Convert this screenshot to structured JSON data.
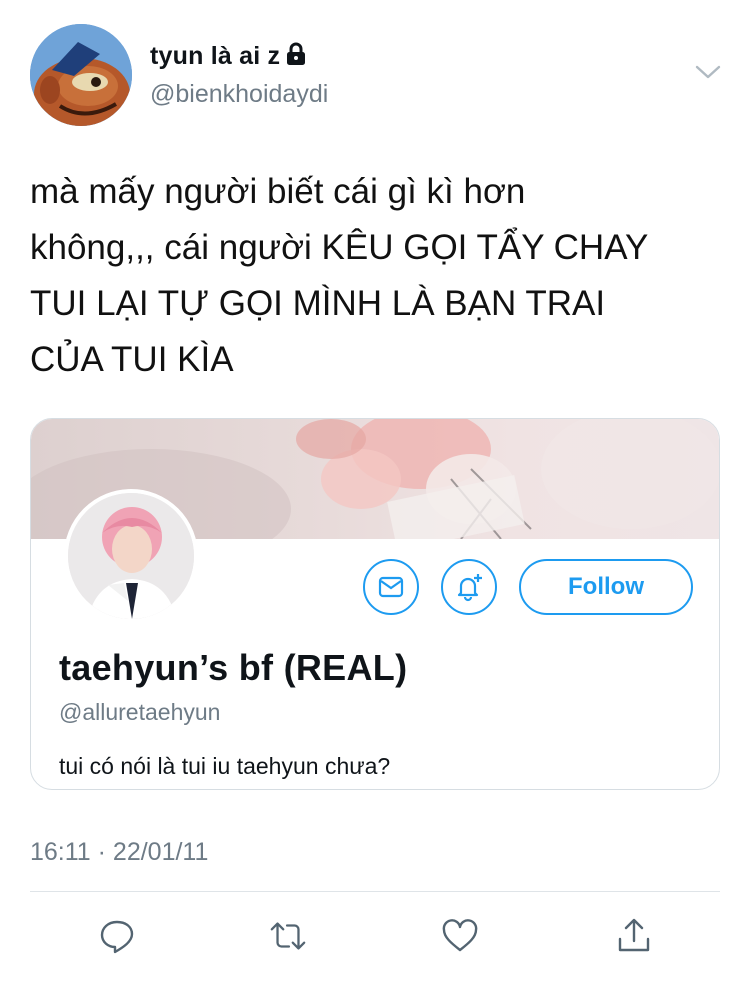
{
  "author": {
    "display_name": "tyun là ai z",
    "handle": "@bienkhoidaydi",
    "protected_icon": "lock-icon",
    "avatar_icon": "cartoon-fish-avatar"
  },
  "tweet": {
    "text": "mà mấy người biết cái gì kì hơn\nkhông,,, cái người KÊU GỌI TẨY CHAY\nTUI LẠI TỰ GỌI MÌNH LÀ BẠN TRAI\nCỦA TUI KÌA",
    "timestamp": "16:11 · 22/01/11"
  },
  "profile_card": {
    "name": "taehyun’s bf (REAL)",
    "handle": "@alluretaehyun",
    "bio": "tui có nói là tui iu taehyun chưa?",
    "follow_label": "Follow",
    "message_icon": "mail-icon",
    "notify_icon": "bell-plus-icon"
  },
  "actions": {
    "icons": [
      "reply-icon",
      "retweet-icon",
      "like-icon",
      "share-icon"
    ]
  },
  "colors": {
    "accent": "#1d9bf0",
    "secondary_text": "#6e7b86",
    "border": "#d6dde2"
  }
}
